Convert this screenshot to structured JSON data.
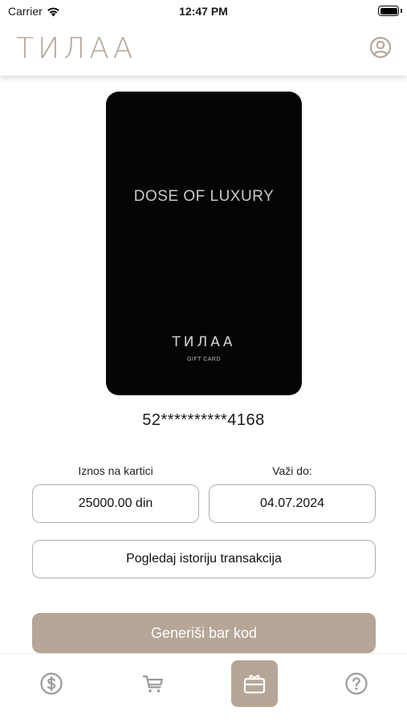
{
  "status_bar": {
    "carrier": "Carrier",
    "time": "12:47 PM"
  },
  "header": {
    "logo_text": "ТИЛАА",
    "profile_icon": "user-circle-icon"
  },
  "gift_card": {
    "tagline": "DOSE OF LUXURY",
    "brand": "ТИЛАА",
    "subtitle": "GIFT CARD",
    "masked_number": "52**********4168"
  },
  "balance": {
    "label": "Iznos na kartici",
    "value": "25000.00 din"
  },
  "validity": {
    "label": "Važi do:",
    "value": "04.07.2024"
  },
  "actions": {
    "history_label": "Pogledaj istoriju transakcija",
    "generate_label": "Generiši bar kod"
  },
  "tabs": [
    {
      "icon": "dollar-circle-icon",
      "active": false
    },
    {
      "icon": "cart-icon",
      "active": false
    },
    {
      "icon": "gift-card-icon",
      "active": true
    },
    {
      "icon": "help-circle-icon",
      "active": false
    }
  ],
  "colors": {
    "accent": "#b5a697",
    "logo": "#b6a698",
    "card": "#050505",
    "border": "#b9aea3"
  }
}
